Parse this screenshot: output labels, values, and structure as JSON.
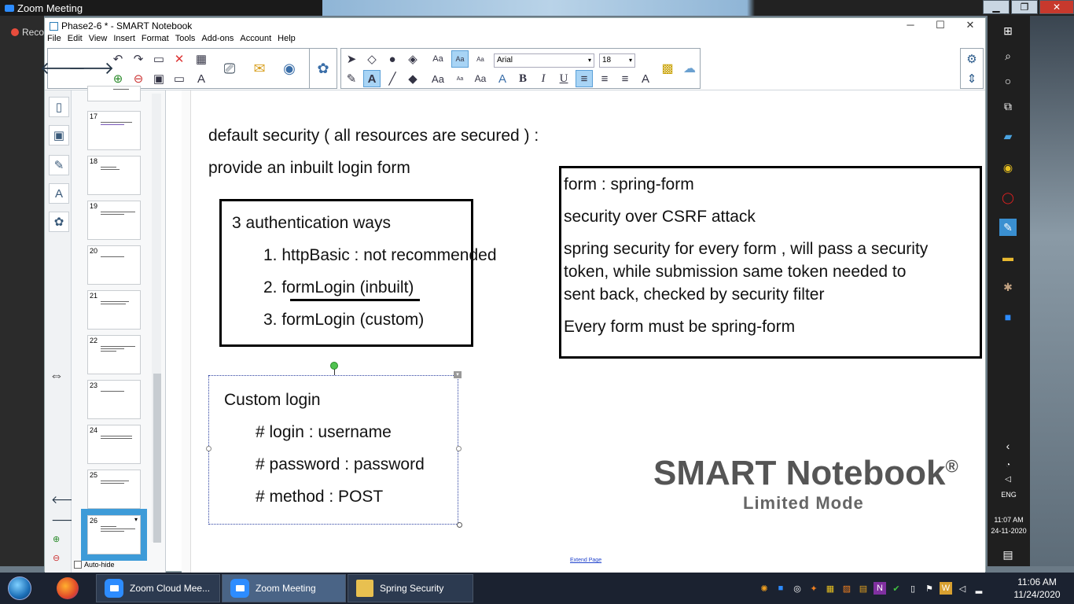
{
  "zoom": {
    "title": "Zoom Meeting",
    "rec": "Reco",
    "ctrls": [
      "▁",
      "❐",
      "✕"
    ]
  },
  "window": {
    "title": "Phase2-6 * - SMART Notebook",
    "min": "─",
    "max": "☐",
    "close": "✕"
  },
  "menu": [
    "File",
    "Edit",
    "View",
    "Insert",
    "Format",
    "Tools",
    "Add-ons",
    "Account",
    "Help"
  ],
  "toolbar": {
    "font": "Arial",
    "size": "18",
    "aa_large": "Aa",
    "aa_small": "Aa",
    "bold": "B",
    "italic": "I",
    "underline": "U"
  },
  "thumbs": [
    {
      "num": "17"
    },
    {
      "num": "18"
    },
    {
      "num": "19"
    },
    {
      "num": "20"
    },
    {
      "num": "21"
    },
    {
      "num": "22"
    },
    {
      "num": "23"
    },
    {
      "num": "24"
    },
    {
      "num": "25"
    },
    {
      "num": "26"
    }
  ],
  "autohide": "Auto-hide",
  "canvas": {
    "line1": "default security ( all resources are secured ) :",
    "line2": "provide an inbuilt login form",
    "box3": {
      "title": "3 authentication ways",
      "item1": "1. httpBasic : not recommended",
      "item2": "2. formLogin (inbuilt)",
      "item3": "3. formLogin (custom)"
    },
    "boxform": {
      "l1": "form : spring-form",
      "l2": "security over CSRF attack",
      "l3a": "spring security for every form , will pass a security",
      "l3b": "token, while submission same token needed to",
      "l3c": "sent back, checked by security filter",
      "l4": "Every form must be spring-form"
    },
    "custom": {
      "title": "Custom login",
      "l1": "# login : username",
      "l2": "# password : password",
      "l3": "# method : POST"
    },
    "watermark": "SMART Notebook",
    "reg": "®",
    "watermark2": "Limited Mode",
    "extend": "Extend Page"
  },
  "winside": {
    "lang": "ENG",
    "time": "11:07 AM",
    "date": "24-11-2020"
  },
  "taskbar": {
    "tasks": [
      "Zoom Cloud Mee...",
      "Zoom Meeting",
      "Spring Security"
    ],
    "time": "11:06 AM",
    "date": "11/24/2020"
  }
}
